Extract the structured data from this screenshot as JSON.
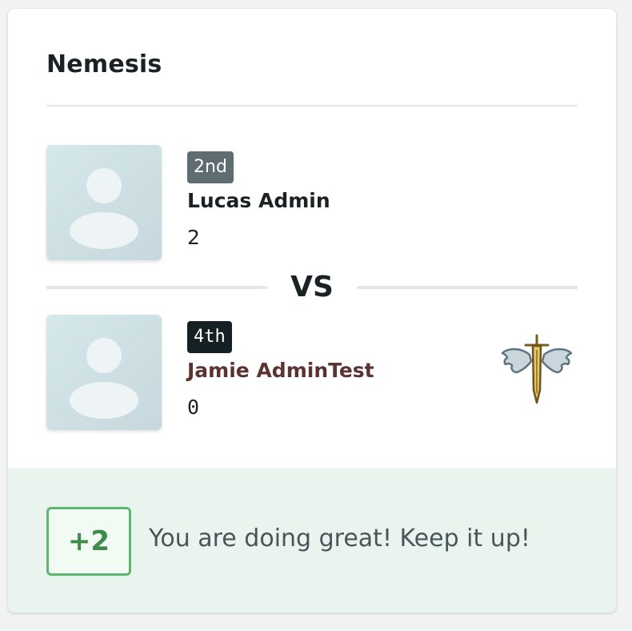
{
  "card": {
    "title": "Nemesis"
  },
  "player": {
    "rank": "2nd",
    "name": "Lucas Admin",
    "score": "2"
  },
  "versus": {
    "label": "VS"
  },
  "nemesis": {
    "rank": "4th",
    "name": "Jamie AdminTest",
    "score": "0",
    "icon": "winged-sword-icon"
  },
  "footer": {
    "difference": "+2",
    "message": "You are doing great! Keep it up!"
  },
  "colors": {
    "positive": "#5db76e",
    "nemesis_name": "#5b3330",
    "footer_bg": "#eaf4ee"
  }
}
